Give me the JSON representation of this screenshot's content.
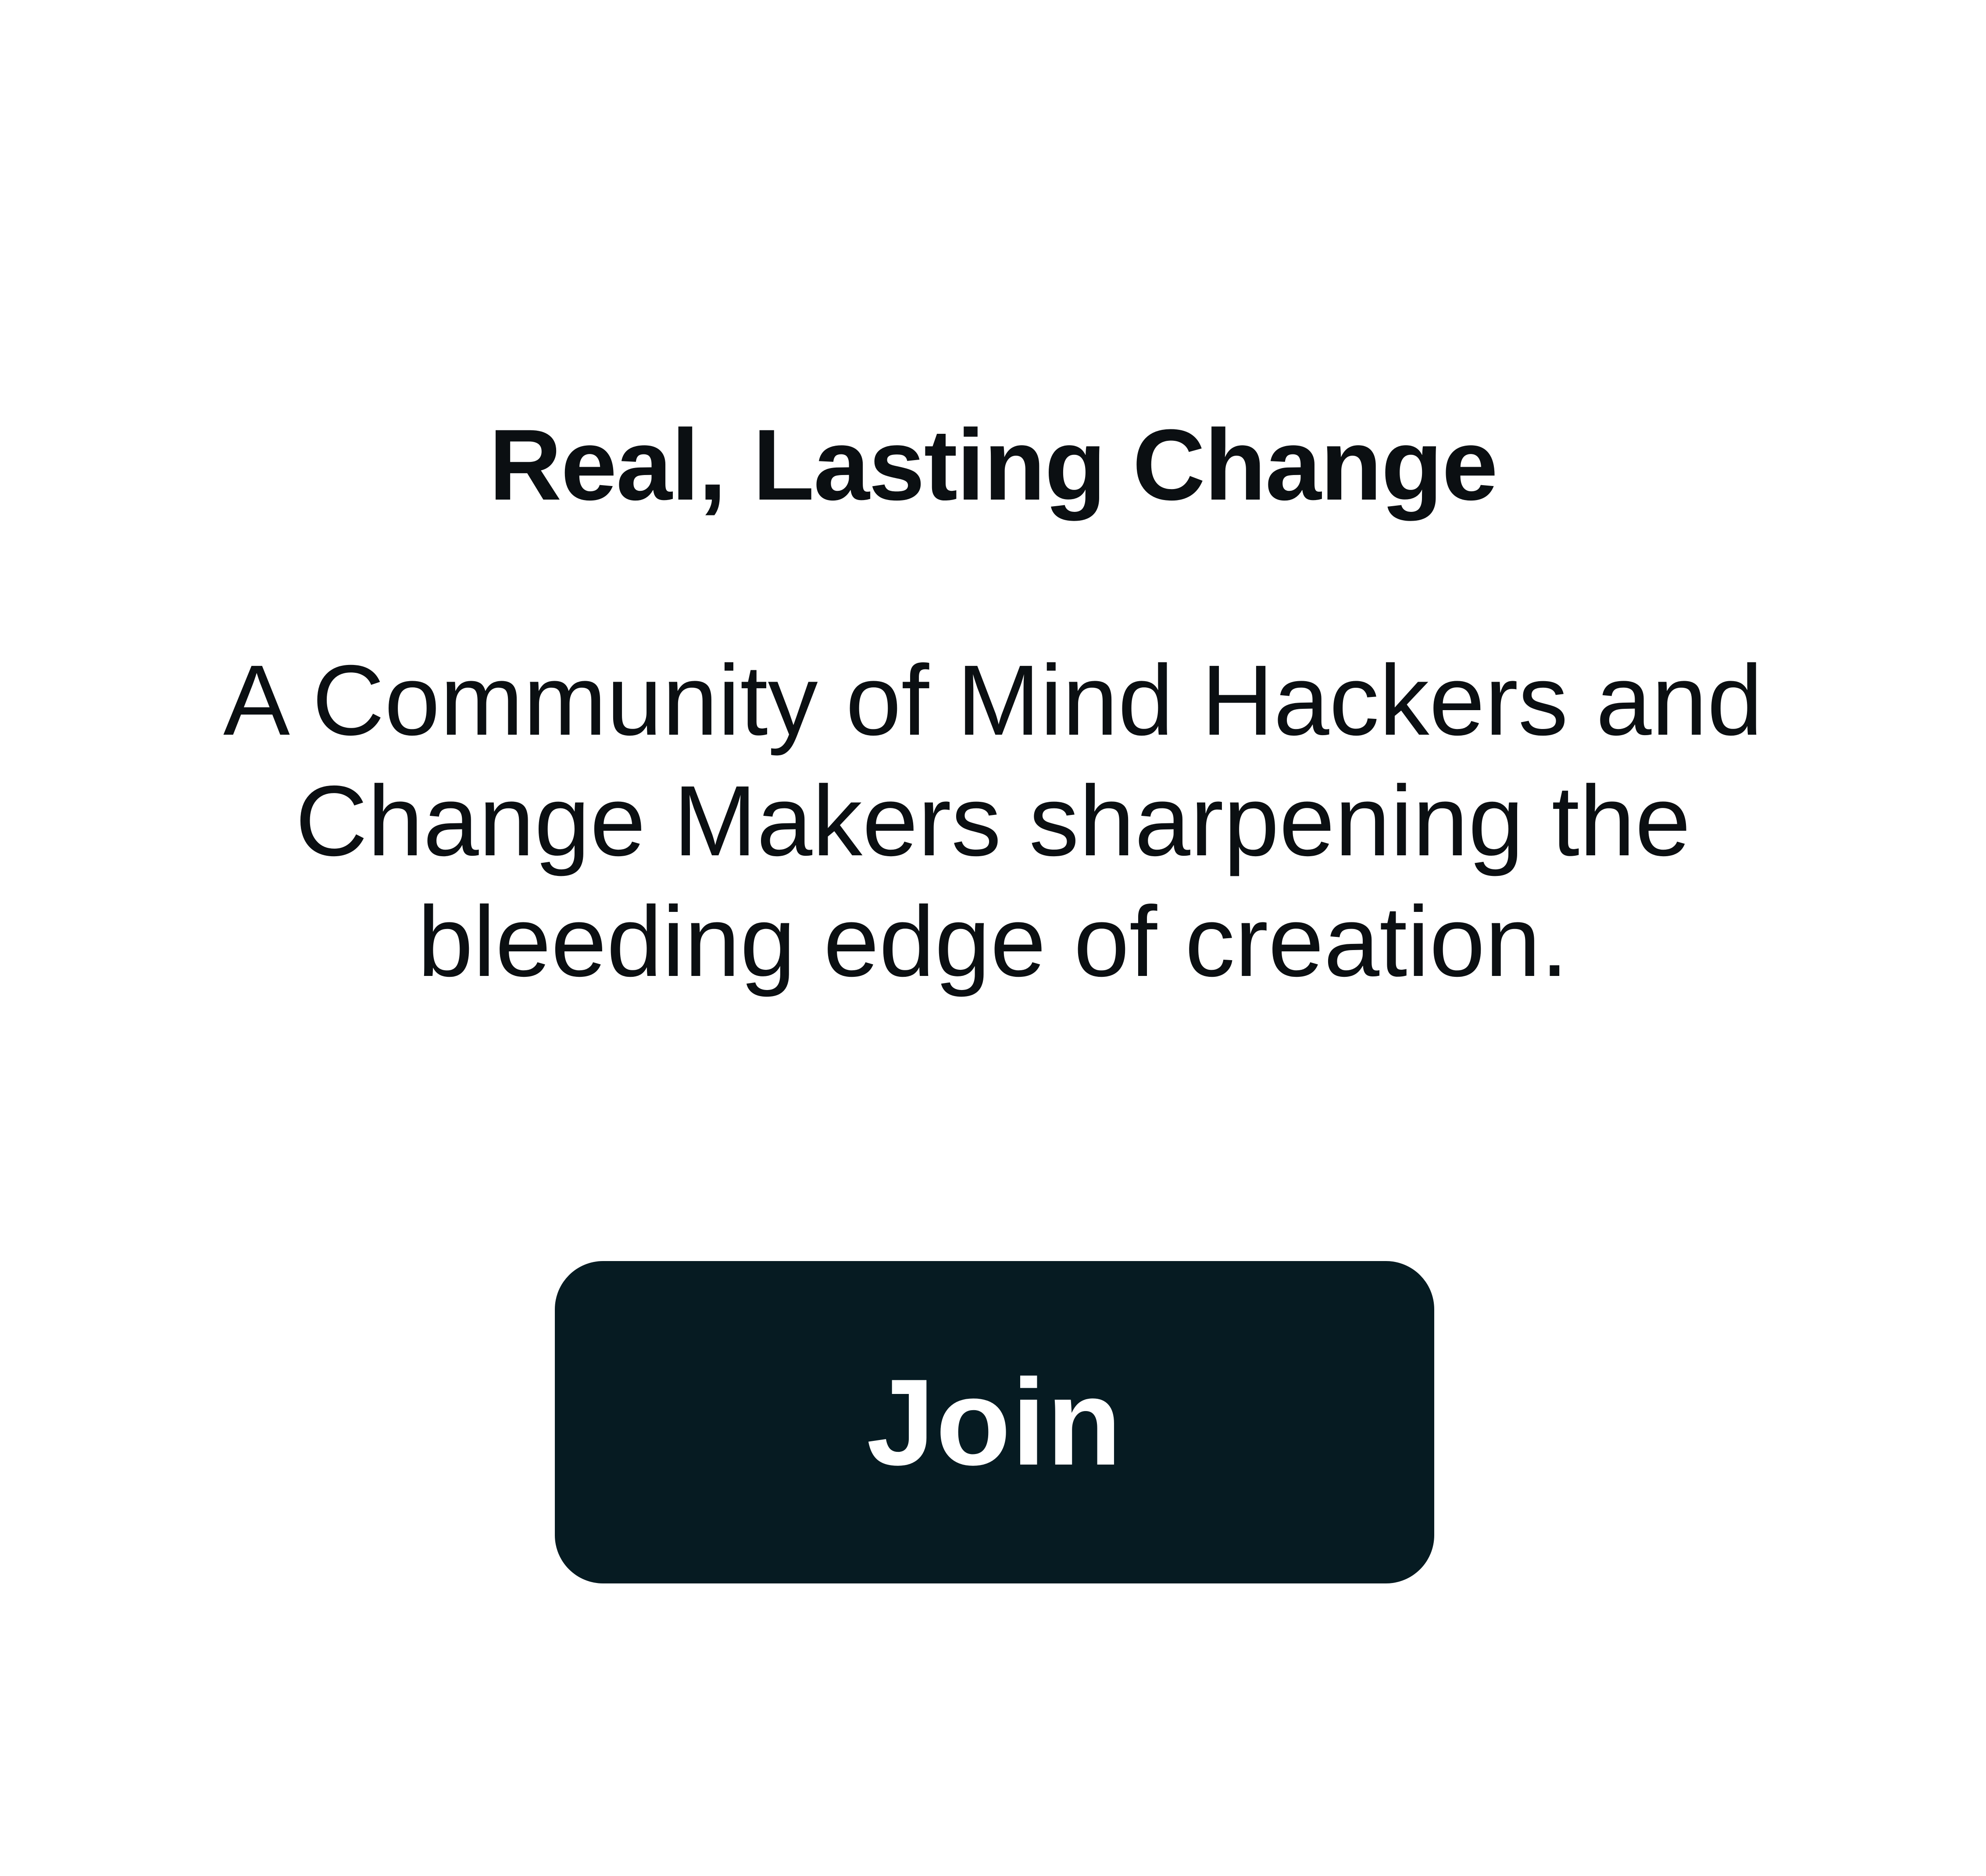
{
  "hero": {
    "headline": "Real, Lasting Change",
    "subtext": "A Community of Mind Hackers and Change Makers sharpening the bleeding edge of creation.",
    "cta_label": "Join"
  },
  "colors": {
    "background": "#ffffff",
    "text": "#0b0f12",
    "button_background": "#061b22",
    "button_text": "#ffffff"
  }
}
